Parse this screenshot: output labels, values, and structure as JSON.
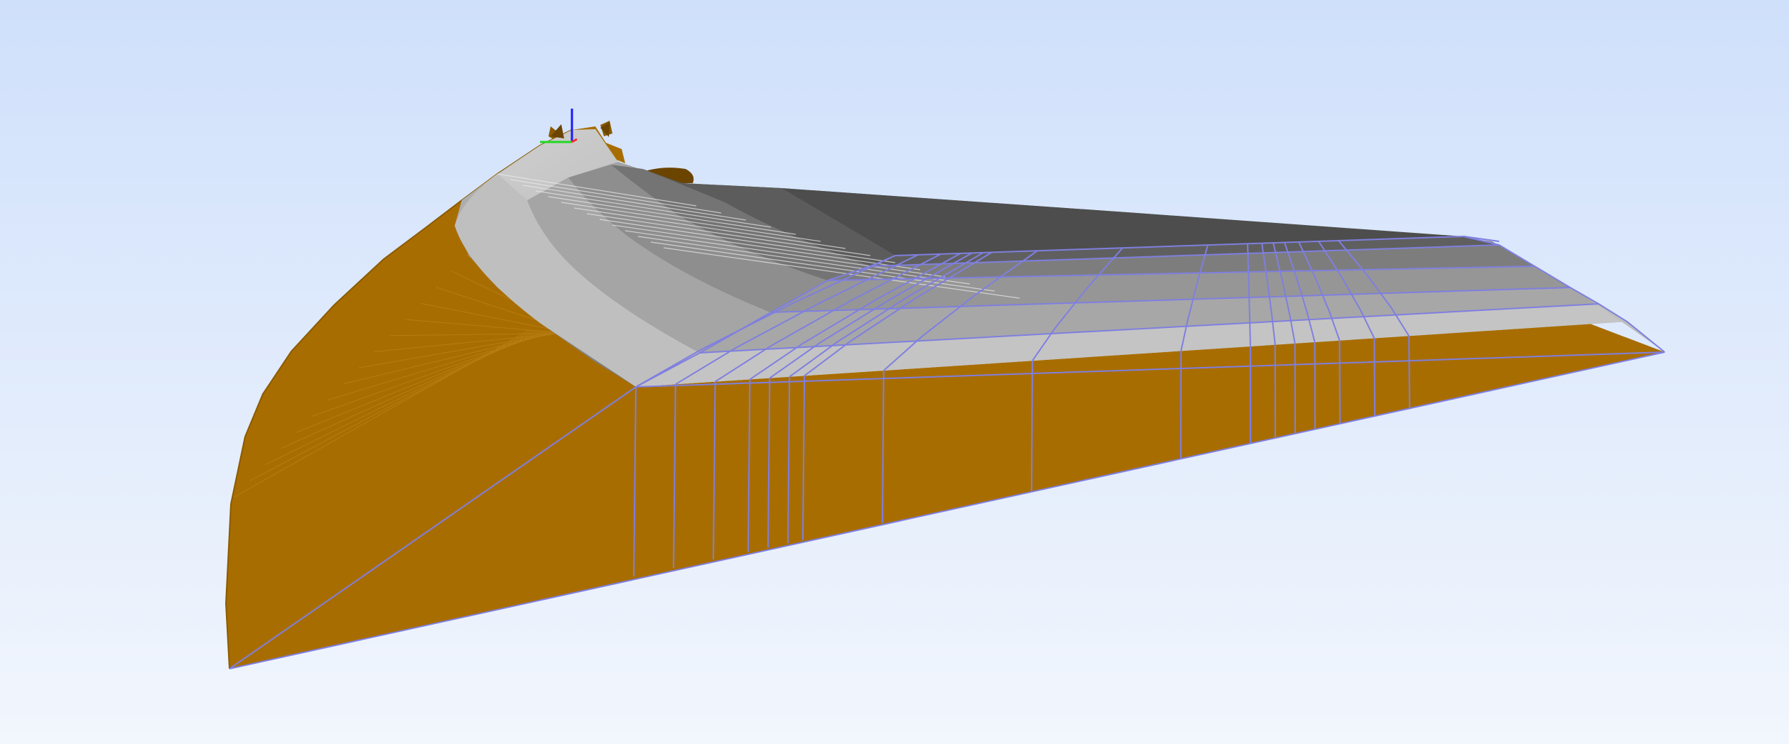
{
  "viewport": {
    "background_top": "#cfe0fb",
    "background_bottom": "#f2f6fd"
  },
  "model": {
    "side_face_color": "#a86d00",
    "side_face_dark_color": "#6b4400",
    "deck_light_color": "#c9c9c9",
    "deck_mid_color": "#9f9f9f",
    "deck_dark_color": "#4a4a4a",
    "wireframe_color": "#7f7fe0"
  },
  "axis_triad": {
    "x_axis_color": "#ff2a2a",
    "y_axis_color": "#22d822",
    "z_axis_color": "#1a1aff",
    "icon": "xyz-axis-triad-icon"
  }
}
